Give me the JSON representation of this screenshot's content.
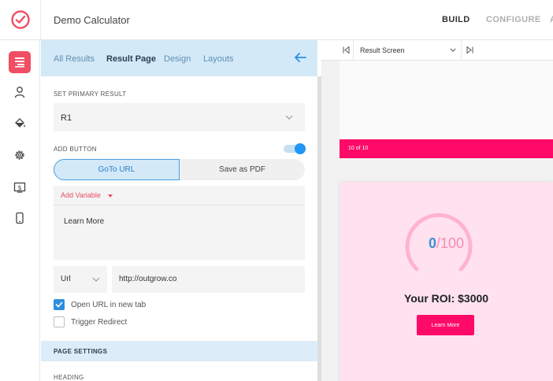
{
  "app": {
    "title": "Demo Calculator",
    "top_tabs": [
      "BUILD",
      "CONFIGURE",
      "A"
    ]
  },
  "rail": {
    "icons": [
      "results-layout-icon",
      "user-icon",
      "paint-bucket-icon",
      "gear-icon",
      "dollar-screen-icon",
      "mobile-icon"
    ]
  },
  "panel": {
    "tabs": [
      "All Results",
      "Result Page",
      "Design",
      "Layouts"
    ],
    "primary_result_label": "SET PRIMARY RESULT",
    "primary_result_value": "R1",
    "add_button_label": "ADD BUTTON",
    "add_button_enabled": true,
    "segment": {
      "left": "GoTo URL",
      "right": "Save as PDF",
      "selected": "GoTo URL"
    },
    "add_variable": "Add Variable",
    "button_text": "Learn More",
    "url_type": "Url",
    "url_value": "http://outgrow.co",
    "open_new_tab_label": "Open URL in new tab",
    "open_new_tab_checked": true,
    "trigger_redirect_label": "Trigger Redirect",
    "trigger_redirect_checked": false,
    "page_settings_label": "PAGE SETTINGS",
    "heading_label": "HEADING"
  },
  "preview": {
    "screen_select": "Result Screen",
    "progress_text": "10 of 10",
    "score_value": "0",
    "score_max": "/100",
    "gauge_fraction": 0,
    "roi_text": "Your ROI: $3000",
    "cta_label": "Learn More"
  },
  "colors": {
    "accent_blue": "#2196f3",
    "brand_pink": "#ff0a68",
    "rail_active": "#f04e64"
  }
}
